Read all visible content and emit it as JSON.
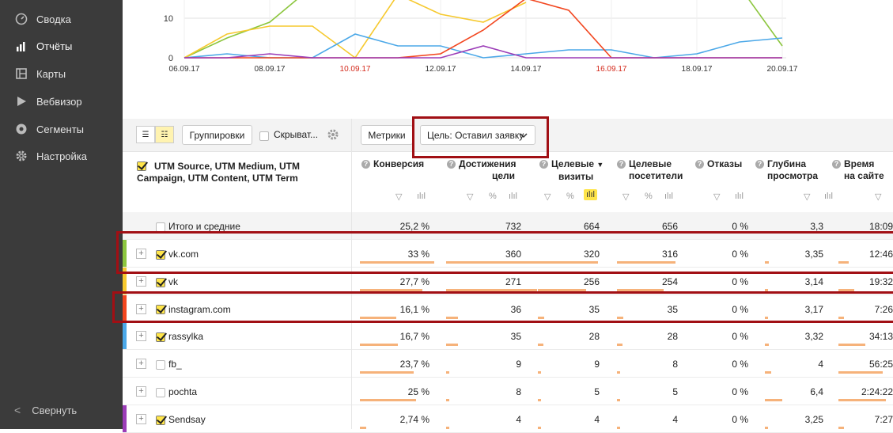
{
  "sidebar": {
    "items": [
      {
        "label": "Сводка",
        "icon": "gauge-icon"
      },
      {
        "label": "Отчёты",
        "icon": "bar-chart-icon"
      },
      {
        "label": "Карты",
        "icon": "map-icon"
      },
      {
        "label": "Вебвизор",
        "icon": "play-icon"
      },
      {
        "label": "Сегменты",
        "icon": "segments-icon"
      },
      {
        "label": "Настройка",
        "icon": "gear-icon"
      }
    ],
    "collapse_label": "Свернуть"
  },
  "chart_data": {
    "type": "line",
    "x": [
      "06.09.17",
      "07.09.17",
      "08.09.17",
      "09.09.17",
      "10.09.17",
      "11.09.17",
      "12.09.17",
      "13.09.17",
      "14.09.17",
      "15.09.17",
      "16.09.17",
      "17.09.17",
      "18.09.17",
      "19.09.17",
      "20.09.17"
    ],
    "x_tick_labels": [
      "06.09.17",
      "08.09.17",
      "10.09.17",
      "12.09.17",
      "14.09.17",
      "16.09.17",
      "18.09.17",
      "20.09.17"
    ],
    "weekend_ticks": [
      "10.09.17",
      "16.09.17"
    ],
    "y_tick_labels": [
      "0",
      "10"
    ],
    "ylim": [
      0,
      15
    ],
    "series": [
      {
        "color": "#8cc63e",
        "values": [
          0,
          5,
          9,
          18,
          null,
          null,
          null,
          null,
          null,
          null,
          null,
          null,
          null,
          18,
          3
        ]
      },
      {
        "color": "#f6c92e",
        "values": [
          0,
          6,
          8,
          8,
          0,
          16,
          11,
          9,
          14,
          null,
          null,
          null,
          null,
          null,
          null
        ]
      },
      {
        "color": "#4ba8e8",
        "values": [
          0,
          1,
          0,
          0,
          6,
          3,
          3,
          0,
          1,
          2,
          2,
          0,
          1,
          4,
          5
        ]
      },
      {
        "color": "#f2461f",
        "values": [
          0,
          0,
          0,
          0,
          0,
          0,
          1,
          7,
          15,
          12,
          0,
          0,
          0,
          0,
          0
        ]
      },
      {
        "color": "#9b3cb7",
        "values": [
          0,
          0,
          1,
          0,
          0,
          0,
          0,
          3,
          0,
          0,
          0,
          0,
          0,
          0,
          0
        ]
      }
    ]
  },
  "toolbar": {
    "groupings_label": "Группировки",
    "hide_label": "Скрыват...",
    "metrics_label": "Метрики",
    "goal_label": "Цель: Оставил заявку"
  },
  "table": {
    "dimension_header": "UTM Source, UTM Medium, UTM Campaign, UTM Content, UTM Term",
    "columns": [
      {
        "l1": "Конверсия",
        "l2": ""
      },
      {
        "l1": "Достижения",
        "l2": "цели"
      },
      {
        "l1": "Целевые",
        "l2": "визиты"
      },
      {
        "l1": "Целевые",
        "l2": "посетители"
      },
      {
        "l1": "Отказы",
        "l2": ""
      },
      {
        "l1": "Глубина",
        "l2": "просмотра"
      },
      {
        "l1": "Время",
        "l2": "на сайте"
      }
    ],
    "sort_arrow": "▼",
    "total": {
      "label": "Итого и средние",
      "values": [
        "25,2 %",
        "732",
        "664",
        "656",
        "0 %",
        "3,3",
        "18:09"
      ]
    },
    "rows": [
      {
        "label": "vk.com",
        "checked": true,
        "color": "#8cc63e",
        "values": [
          "33 %",
          "360",
          "320",
          "316",
          "0 %",
          "3,35",
          "12:46"
        ]
      },
      {
        "label": "vk",
        "checked": true,
        "color": "#f6c92e",
        "values": [
          "27,7 %",
          "271",
          "256",
          "254",
          "0 %",
          "3,14",
          "19:32"
        ]
      },
      {
        "label": "instagram.com",
        "checked": true,
        "color": "#f2461f",
        "values": [
          "16,1 %",
          "36",
          "35",
          "35",
          "0 %",
          "3,17",
          "7:26"
        ]
      },
      {
        "label": "rassylka",
        "checked": true,
        "color": "#4ba8e8",
        "values": [
          "16,7 %",
          "35",
          "28",
          "28",
          "0 %",
          "3,32",
          "34:13"
        ]
      },
      {
        "label": "fb_",
        "checked": false,
        "color": "",
        "values": [
          "23,7 %",
          "9",
          "9",
          "8",
          "0 %",
          "4",
          "56:25"
        ]
      },
      {
        "label": "pochta",
        "checked": false,
        "color": "",
        "values": [
          "25 %",
          "8",
          "5",
          "5",
          "0 %",
          "6,4",
          "2:24:22"
        ]
      },
      {
        "label": "Sendsay",
        "checked": true,
        "color": "#9b3cb7",
        "values": [
          "2,74 %",
          "4",
          "4",
          "4",
          "0 %",
          "3,25",
          "7:27"
        ]
      }
    ]
  }
}
